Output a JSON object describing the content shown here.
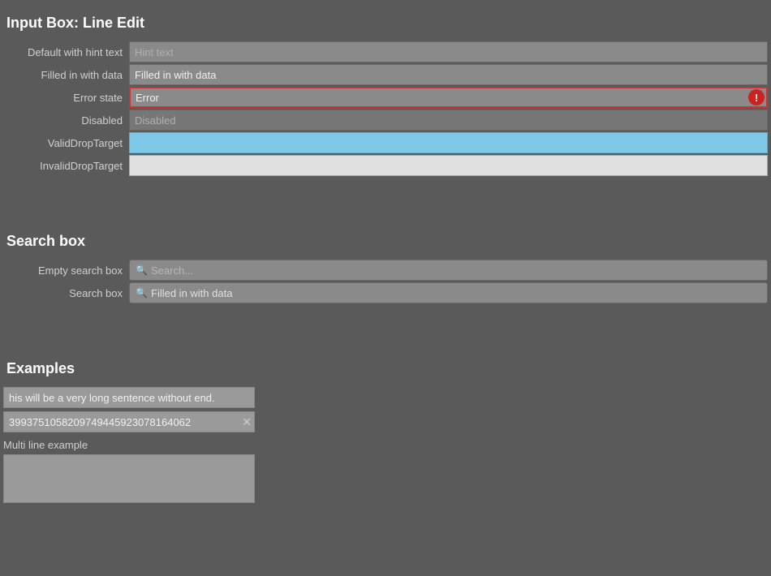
{
  "page": {
    "title": "Input Box: Line Edit",
    "sections": {
      "line_edit": {
        "rows": [
          {
            "label": "Default with hint text",
            "type": "hint",
            "placeholder": "Hint text",
            "value": ""
          },
          {
            "label": "Filled in with data",
            "type": "filled",
            "placeholder": "",
            "value": "Filled in with data"
          },
          {
            "label": "Error state",
            "type": "error",
            "placeholder": "",
            "value": "Error"
          },
          {
            "label": "Disabled",
            "type": "disabled",
            "placeholder": "Disabled",
            "value": ""
          },
          {
            "label": "ValidDropTarget",
            "type": "valid-drop",
            "placeholder": "",
            "value": ""
          },
          {
            "label": "InvalidDropTarget",
            "type": "invalid-drop",
            "placeholder": "",
            "value": ""
          }
        ]
      },
      "search_box": {
        "title": "Search box",
        "rows": [
          {
            "label": "Empty search box",
            "placeholder": "Search...",
            "value": ""
          },
          {
            "label": "Search box",
            "placeholder": "",
            "value": "Filled in with data"
          }
        ]
      },
      "examples": {
        "title": "Examples",
        "long_text": "his will be a very long sentence without end.",
        "number_text": "3993751058209749445923078164062",
        "multiline_label": "Multi line example",
        "multiline_value": ""
      }
    }
  }
}
